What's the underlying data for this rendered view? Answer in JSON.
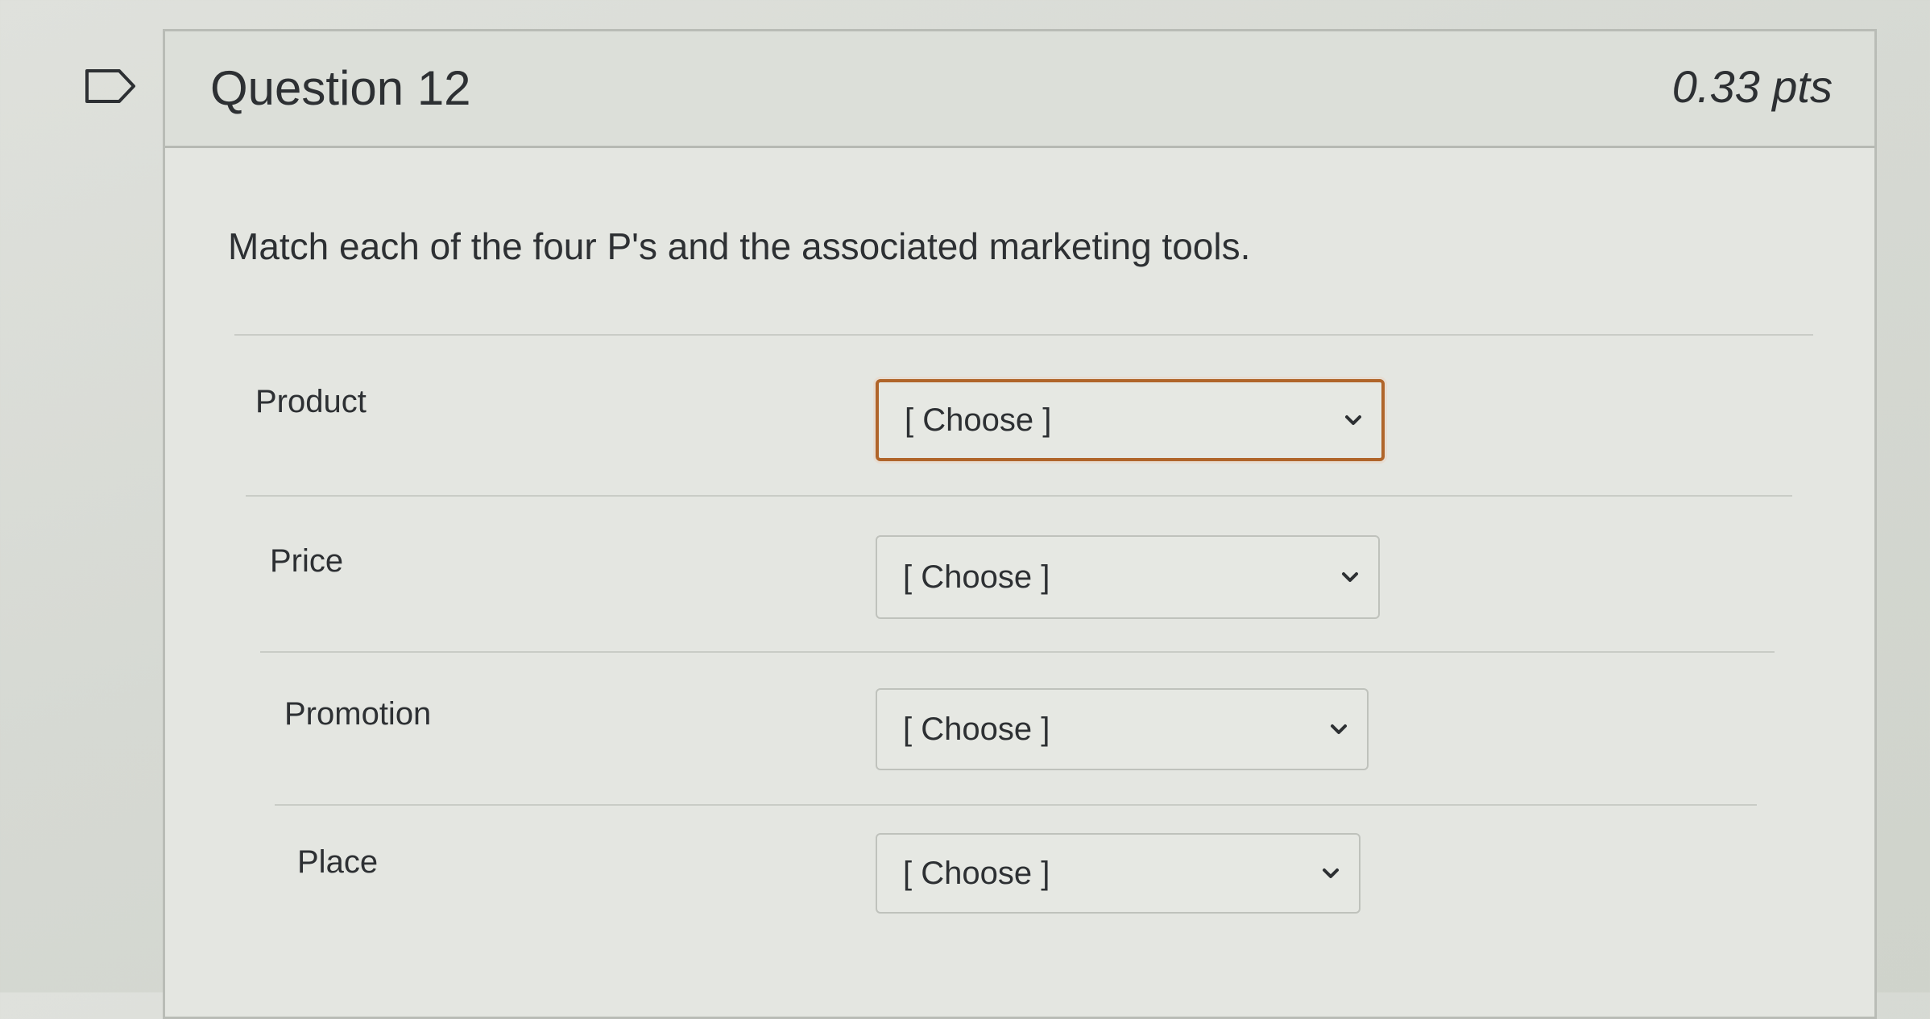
{
  "question": {
    "title": "Question 12",
    "points": "0.33 pts",
    "prompt": "Match each of the four P's and the associated marketing tools."
  },
  "rows": [
    {
      "label": "Product",
      "selected": "[ Choose ]",
      "focused": true
    },
    {
      "label": "Price",
      "selected": "[ Choose ]",
      "focused": false
    },
    {
      "label": "Promotion",
      "selected": "[ Choose ]",
      "focused": false
    },
    {
      "label": "Place",
      "selected": "[ Choose ]",
      "focused": false
    }
  ],
  "icons": {
    "flag": "bookmark-flag-icon",
    "dropdown": "chevron-down-icon"
  },
  "colors": {
    "focus_border": "#b0652a",
    "text": "#2d3033"
  }
}
